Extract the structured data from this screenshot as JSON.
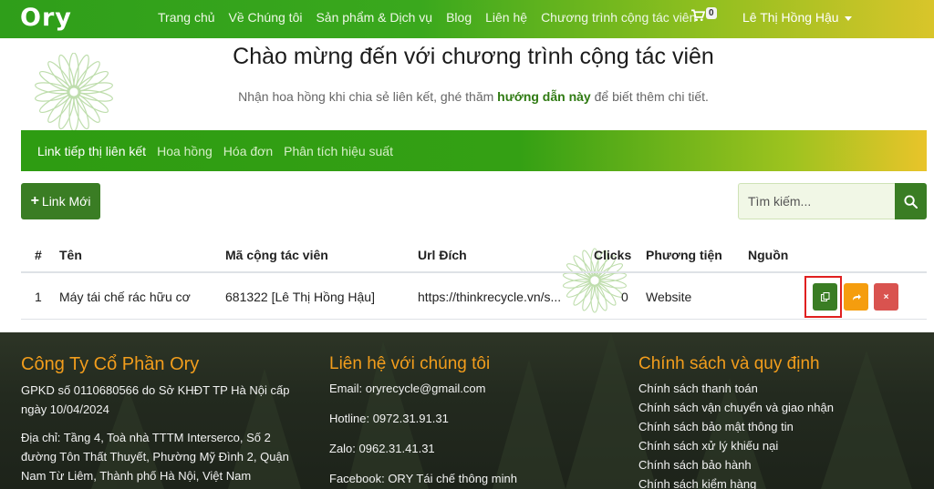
{
  "brand": {
    "logo": "Ory",
    "accent": "#3aa81d",
    "orange": "#f29d1c"
  },
  "nav": {
    "items": [
      "Trang chủ",
      "Về Chúng tôi",
      "Sản phẩm & Dịch vụ",
      "Blog",
      "Liên hệ",
      "Chương trình cộng tác viên"
    ],
    "cart_count": "0",
    "user_name": "Lê Thị Hồng Hậu"
  },
  "header": {
    "title": "Chào mừng đến với chương trình cộng tác viên",
    "subtitle_prefix": "Nhận hoa hồng khi chia sẻ liên kết, ghé thăm ",
    "subtitle_link": "hướng dẫn này",
    "subtitle_suffix": " để biết thêm chi tiết."
  },
  "tabs": [
    "Link tiếp thị liên kết",
    "Hoa hồng",
    "Hóa đơn",
    "Phân tích hiệu suất"
  ],
  "toolbar": {
    "new_link_label": "Link Mới",
    "search_placeholder": "Tìm kiếm..."
  },
  "table": {
    "columns": [
      "#",
      "Tên",
      "Mã cộng tác viên",
      "Url Đích",
      "Clicks",
      "Phương tiện",
      "Nguồn"
    ],
    "rows": [
      {
        "index": "1",
        "name": "Máy tái chế rác hữu cơ",
        "code": "681322 [Lê Thị Hồng Hậu]",
        "url": "https://thinkrecycle.vn/s...",
        "clicks": "0",
        "medium": "Website",
        "source": ""
      }
    ]
  },
  "footer": {
    "company": {
      "title": "Công Ty Cổ Phần Ory",
      "license_1": "GPKD số 0110680566 do Sở KHĐT TP Hà Nội cấp",
      "license_2": "ngày 10/04/2024",
      "address_1": "Địa chỉ: Tầng 4, Toà nhà TTTM Interserco, Số 2",
      "address_2": "đường Tôn Thất Thuyết, Phường Mỹ Đình 2, Quận",
      "address_3": "Nam Từ Liêm, Thành phố Hà Nội, Việt Nam"
    },
    "contact": {
      "title": "Liên hệ với chúng tôi",
      "email": "Email: oryrecycle@gmail.com",
      "hotline": "Hotline: 0972.31.91.31",
      "zalo": "Zalo: 0962.31.41.31",
      "facebook": "Facebook: ORY Tái chế thông minh"
    },
    "policy": {
      "title": "Chính sách và quy định",
      "items": [
        "Chính sách thanh toán",
        "Chính sách vận chuyển và giao nhận",
        "Chính sách bảo mật thông tin",
        "Chính sách xử lý khiếu nại",
        "Chính sách bảo hành",
        "Chính sách kiểm hàng"
      ]
    }
  }
}
